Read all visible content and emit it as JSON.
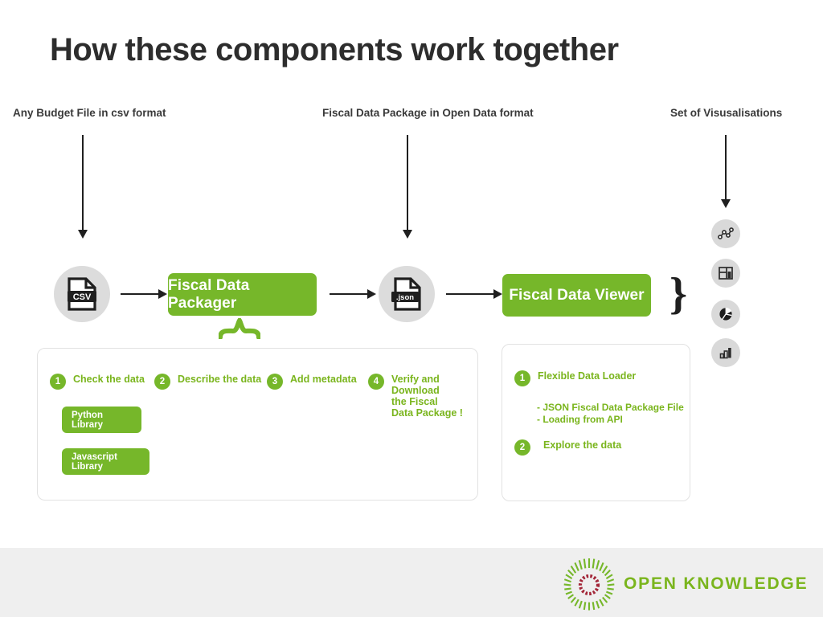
{
  "slide": {
    "title": "How these components work together",
    "background": "#ffffff",
    "accent_green": "#76b72a",
    "text_green": "#7ab51d",
    "arrow_color": "#1f1f1f",
    "circle_grey": "#dcdcdc",
    "footer_grey": "#efefef",
    "logo_ring_color": "#a32638"
  },
  "captions": [
    {
      "text": "Any Budget File in csv format",
      "name": "caption-csv-input"
    },
    {
      "text": "Fiscal Data Package in Open Data format",
      "name": "caption-fdp"
    },
    {
      "text": "Set of Visusalisations",
      "name": "caption-visualisations"
    }
  ],
  "flow": {
    "csv_icon_label": "CSV",
    "json_icon_label": ".json",
    "packager_label": "Fiscal Data Packager",
    "viewer_label": "Fiscal Data Viewer"
  },
  "packager_card": {
    "steps": [
      {
        "num": "1",
        "label": "Check the data"
      },
      {
        "num": "2",
        "label": "Describe the data"
      },
      {
        "num": "3",
        "label": "Add metadata"
      },
      {
        "num": "4",
        "label": "Verify and\nDownload\nthe Fiscal\nData Package !"
      }
    ],
    "buttons": [
      {
        "label": "Python Library"
      },
      {
        "label": "Javascript Library"
      }
    ]
  },
  "viewer_card": {
    "steps": [
      {
        "num": "1",
        "label": "Flexible Data Loader"
      },
      {
        "num": "2",
        "label": "Explore the data"
      }
    ],
    "sub_items": "- JSON Fiscal Data Package File\n- Loading from API"
  },
  "visualisation_icons": [
    {
      "name": "line-chart-icon"
    },
    {
      "name": "treemap-icon"
    },
    {
      "name": "pie-chart-icon"
    },
    {
      "name": "bar-chart-icon"
    }
  ],
  "footer": {
    "logo_text": "OPEN KNOWLEDGE"
  }
}
